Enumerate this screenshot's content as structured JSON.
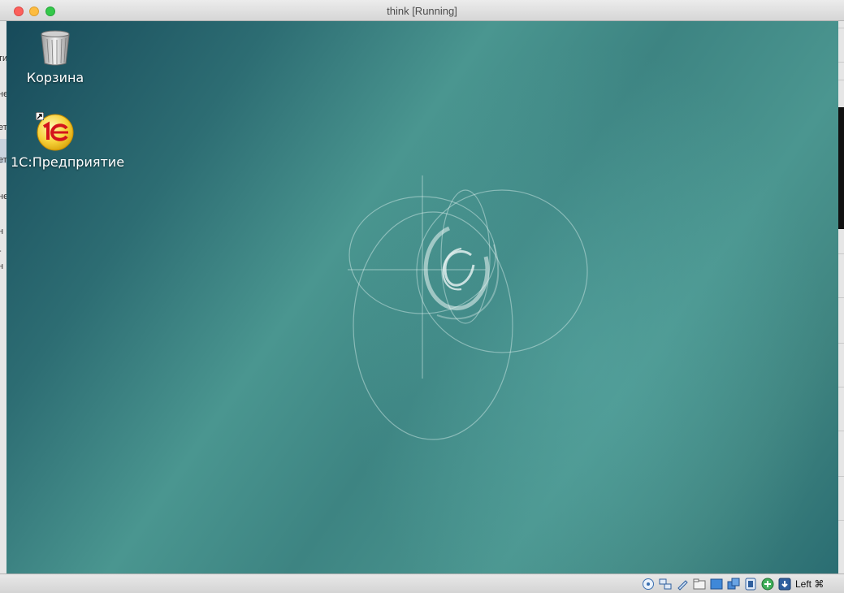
{
  "window": {
    "title": "think [Running]"
  },
  "desktop": {
    "icons": [
      {
        "label": "Корзина",
        "icon": "trash-icon"
      },
      {
        "label": "1С:Предприятие",
        "icon": "1c-enterprise-icon"
      }
    ]
  },
  "host_fragments": [
    "ти",
    "не",
    "ет",
    "ет",
    "не",
    "н",
    "-",
    "н"
  ],
  "statusbar": {
    "icons": [
      "optical-drive-icon",
      "network-icon",
      "usb-icon",
      "shared-folders-icon",
      "display-icon",
      "video-capture-icon",
      "cpu-icon",
      "mouse-integration-icon",
      "keyboard-capture-icon"
    ],
    "host_key": "Left ⌘"
  },
  "colors": {
    "desktop_dark": "#174a5a",
    "desktop_light": "#4a9690"
  }
}
